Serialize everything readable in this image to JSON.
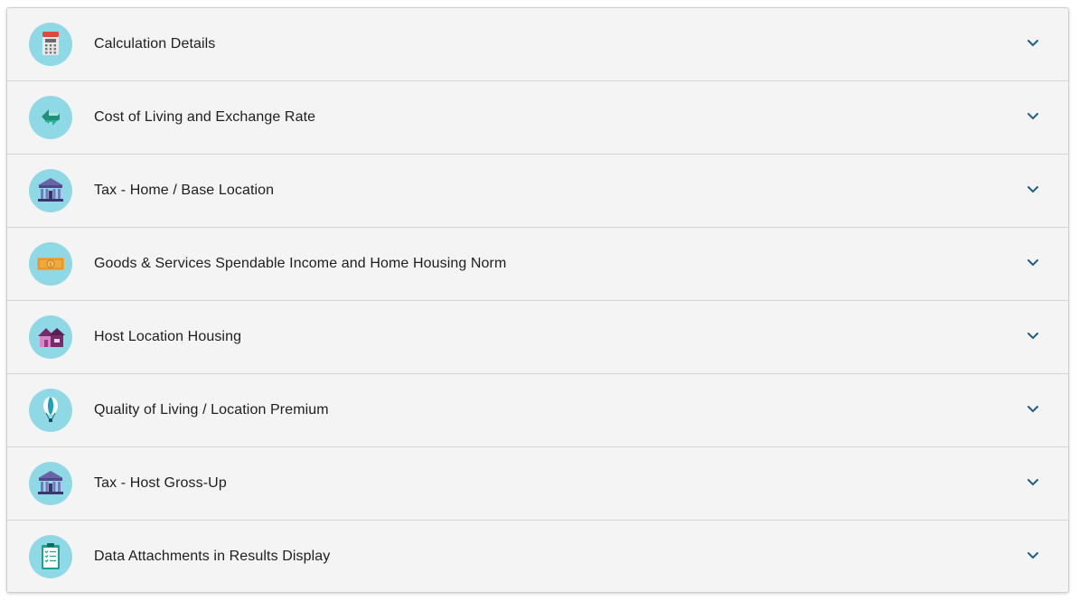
{
  "accordion": {
    "sections": [
      {
        "label": "Calculation Details",
        "icon": "calculator-icon"
      },
      {
        "label": "Cost of Living and Exchange Rate",
        "icon": "exchange-arrows-icon"
      },
      {
        "label": "Tax - Home / Base Location",
        "icon": "bank-building-icon"
      },
      {
        "label": "Goods & Services Spendable Income and Home Housing Norm",
        "icon": "money-bill-icon"
      },
      {
        "label": "Host Location Housing",
        "icon": "houses-icon"
      },
      {
        "label": "Quality of Living / Location Premium",
        "icon": "hot-air-balloon-icon"
      },
      {
        "label": "Tax - Host Gross-Up",
        "icon": "bank-building-icon"
      },
      {
        "label": "Data Attachments in Results Display",
        "icon": "clipboard-checklist-icon"
      }
    ]
  },
  "colors": {
    "icon_circle": "#8fd9e6",
    "chevron": "#1f5d86",
    "panel_background": "#f4f4f4",
    "divider": "#d5d5d5"
  }
}
